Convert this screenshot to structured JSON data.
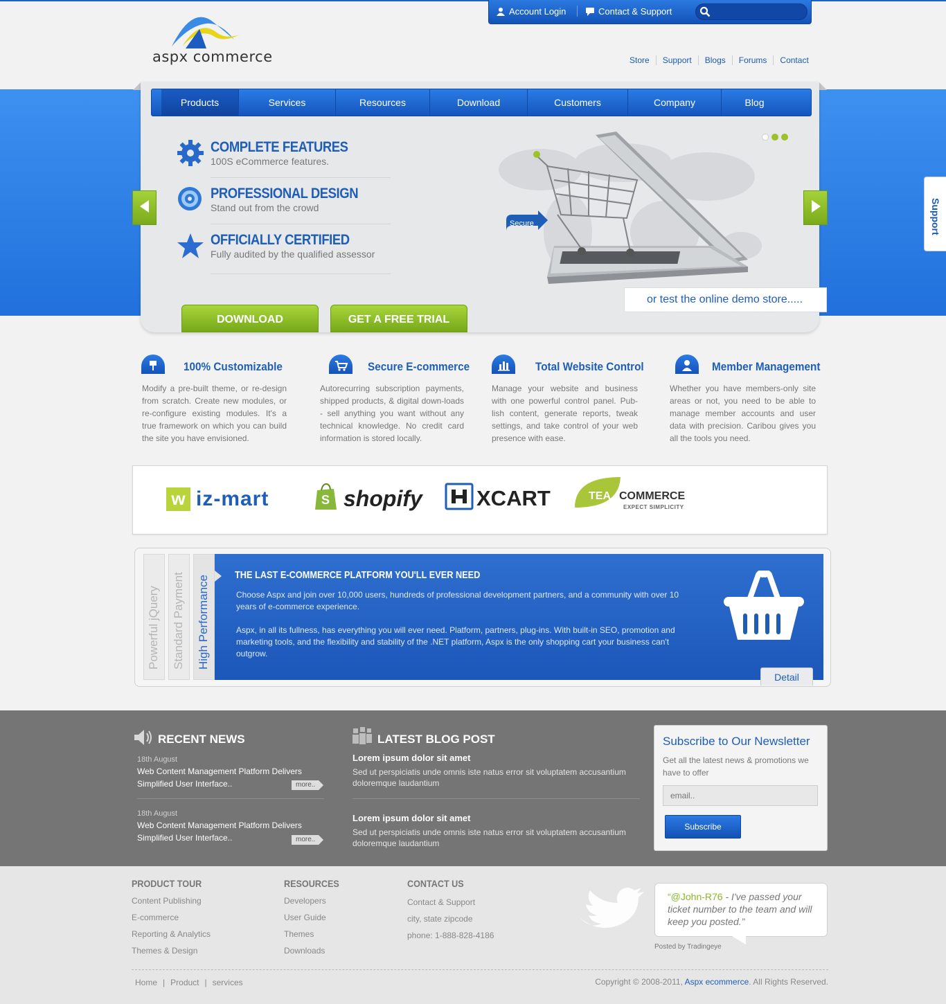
{
  "header": {
    "logo_text": "aspx commerce",
    "account_login": "Account Login",
    "contact_support": "Contact & Support",
    "search_placeholder": "",
    "top_links": [
      "Store",
      "Support",
      "Blogs",
      "Forums",
      "Contact"
    ]
  },
  "nav": {
    "items": [
      "Products",
      "Services",
      "Resources",
      "Download",
      "Customers",
      "Company",
      "Blog"
    ],
    "active": "Products"
  },
  "hero": {
    "features": [
      {
        "title": "COMPLETE FEATURES",
        "sub": "100S eCommerce features.",
        "icon": "gear-icon"
      },
      {
        "title": "PROFESSIONAL DESIGN",
        "sub": "Stand out from the crowd",
        "icon": "swirl-icon"
      },
      {
        "title": "OFFICIALLY CERTIFIED",
        "sub": "Fully audited by the qualified assessor",
        "icon": "star-icon"
      }
    ],
    "secure_label": "Secure",
    "download_btn": "DOWNLOAD",
    "trial_btn": "GET A FREE TRIAL",
    "demo_text": "or test the online demo store.....",
    "support_tab": "Support"
  },
  "columns": [
    {
      "title": "100% Customizable",
      "icon": "pin-icon",
      "text": "Modify a pre-built theme, or re-design from scratch. Create new modules, or re-configure existing modules. It's a true framework on which you can build the site you have envisioned."
    },
    {
      "title": "Secure E-commerce",
      "icon": "cart-icon",
      "text": "Autorecurring subscription payments, shipped products, & digital down-loads - sell anything you want without any technical knowledge. No credit card information is stored locally."
    },
    {
      "title": "Total Website Control",
      "icon": "bar-chart-icon",
      "text": "Manage your website and business with one powerful control panel. Pub-lish content, generate reports, tweak settings, and take control of your web presence with ease."
    },
    {
      "title": "Member Management",
      "icon": "user-icon",
      "text": "Whether you have members-only site areas or not, you need to be able to manage member accounts and user data with precision. Caribou gives you all the tools you need."
    }
  ],
  "partners": {
    "wizmart": "iz-mart",
    "wizmart_w": "w",
    "shopify": "shopify",
    "xcart": "XCART",
    "tea1": "TEA",
    "tea2": "COMMERCE",
    "tea3": "EXPECT SIMPLICITY"
  },
  "platform": {
    "tabs": [
      "Powerful jQuery",
      "Standard Payment",
      "High Performance"
    ],
    "title": "THE LAST E-COMMERCE PLATFORM YOU'LL EVER NEED",
    "para1": "Choose Aspx and join over 10,000 users, hundreds of professional development partners, and a community with over 10 years of e-commerce experience.",
    "para2": "Aspx, in all its fullness, has everything you will ever need. Platform, partners, plug-ins. With built-in SEO, promotion and marketing tools, and the flexibility and stability of the .NET platform, Aspx is the only shopping cart your business can't outgrow.",
    "detail_btn": "Detail"
  },
  "news": {
    "title": "RECENT NEWS",
    "items": [
      {
        "date": "18th August",
        "text": "Web Content Management Platform Delivers Simplified User Interface..",
        "more": "more.."
      },
      {
        "date": "18th August",
        "text": "Web Content Management Platform Delivers Simplified User Interface..",
        "more": "more.."
      }
    ]
  },
  "blog": {
    "title": "LATEST BLOG POST",
    "posts": [
      {
        "title": "Lorem ipsum dolor sit amet",
        "text": "Sed ut perspiciatis unde omnis iste natus error sit voluptatem accusantium doloremque laudantium"
      },
      {
        "title": "Lorem ipsum dolor sit amet",
        "text": "Sed ut perspiciatis unde omnis iste natus error sit voluptatem accusantium doloremque laudantium"
      }
    ]
  },
  "newsletter": {
    "title": "Subscribe to Our Newsletter",
    "text": "Get all the latest news & promotions we have to offer",
    "placeholder": "email..",
    "button": "Subscribe"
  },
  "footer": {
    "product_tour": {
      "title": "PRODUCT TOUR",
      "links": [
        "Content Publishing",
        "E-commerce",
        "Reporting & Analytics",
        "Themes & Design"
      ]
    },
    "resources": {
      "title": "RESOURCES",
      "links": [
        "Developers",
        "User Guide",
        "Themes",
        "Downloads"
      ]
    },
    "contact": {
      "title": "CONTACT US",
      "links": [
        "Contact & Support",
        "city, state zipcode",
        "phone: 1-888-828-4186"
      ]
    },
    "tweet_handle": "“@John-R76",
    "tweet_text": " - I've passed your ticket number to the team and will keep you posted.”",
    "posted_by": "Posted by Tradingeye",
    "bottom_links": [
      "Home",
      "Product",
      "services"
    ],
    "copyright_pre": "Copyright © 2008-2011,",
    "copyright_link": "Aspx ecommerce",
    "copyright_post": ". All Rights Reserved."
  },
  "colors": {
    "brand_blue": "#1f5eb7",
    "accent_green": "#8ab72a",
    "gray_band": "#757575"
  }
}
